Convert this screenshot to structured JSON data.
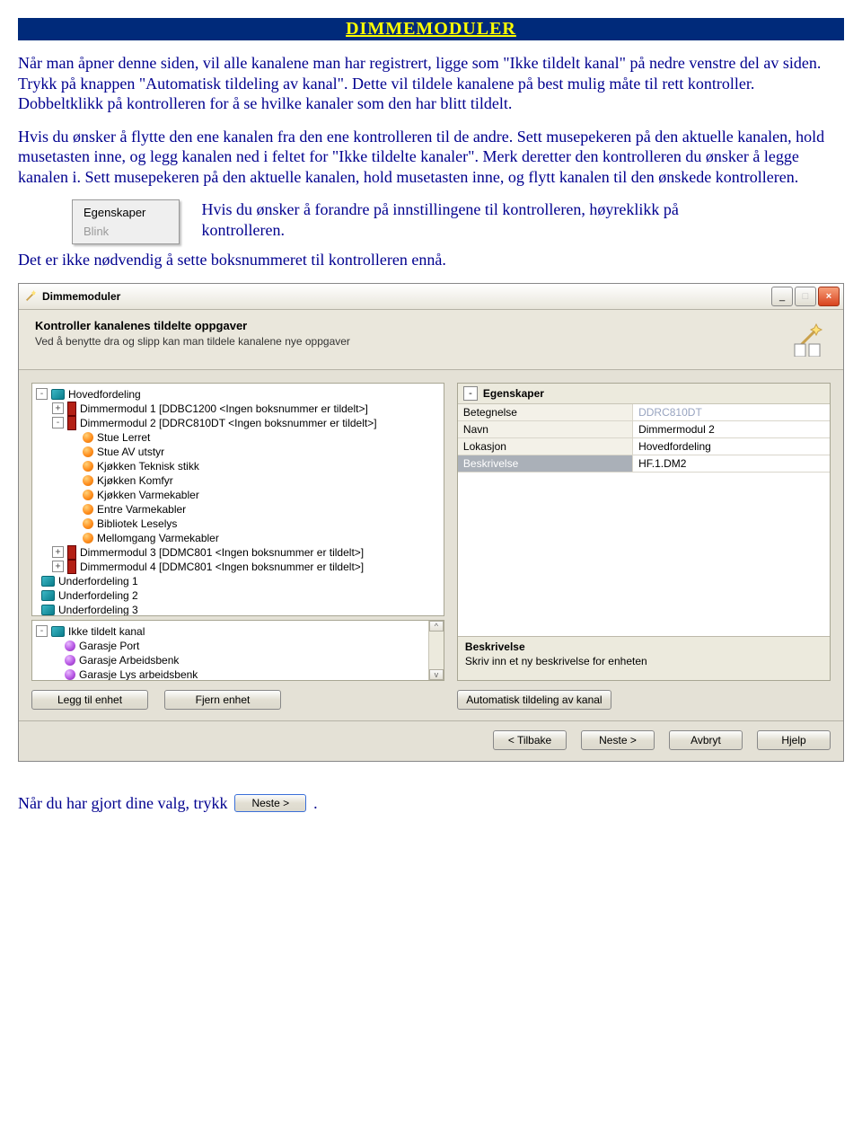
{
  "title": "DIMMEMODULER",
  "para1": "Når man åpner denne siden, vil alle kanalene man har registrert, ligge som \"Ikke tildelt kanal\" på nedre venstre del av siden.",
  "para2": "Trykk på knappen \"Automatisk tildeling av kanal\". Dette vil tildele kanalene på best mulig måte til rett kontroller.",
  "para3": "Dobbeltklikk på kontrolleren for å se hvilke kanaler som den har blitt tildelt.",
  "para4": "Hvis du ønsker å flytte den ene kanalen fra den ene kontrolleren til de andre. Sett musepekeren på den aktuelle kanalen, hold musetasten inne, og legg kanalen ned i feltet for \"Ikke tildelte kanaler\". Merk deretter den kontrolleren du ønsker å legge kanalen i. Sett musepekeren på den aktuelle kanalen, hold musetasten inne, og flytt kanalen til den ønskede kontrolleren.",
  "context_menu": {
    "item1": "Egenskaper",
    "item2": "Blink"
  },
  "para5_right": "Hvis du ønsker å forandre på innstillingene til kontrolleren, høyreklikk på kontrolleren.",
  "para6": "Det er ikke nødvendig å sette boksnummeret til kontrolleren ennå.",
  "window": {
    "title": "Dimmemoduler",
    "header_title": "Kontroller kanalenes tildelte oppgaver",
    "header_sub": "Ved å benytte dra og slipp kan man tildele kanalene nye oppgaver",
    "tree": {
      "root": "Hovedfordeling",
      "dm1": "Dimmermodul 1 [DDBC1200 <Ingen boksnummer er tildelt>]",
      "dm2": "Dimmermodul 2 [DDRC810DT <Ingen boksnummer er tildelt>]",
      "dm2_children": [
        "Stue Lerret",
        "Stue AV utstyr",
        "Kjøkken Teknisk stikk",
        "Kjøkken Komfyr",
        "Kjøkken Varmekabler",
        "Entre Varmekabler",
        "Bibliotek Leselys",
        "Mellomgang Varmekabler"
      ],
      "dm3": "Dimmermodul 3 [DDMC801 <Ingen boksnummer er tildelt>]",
      "dm4": "Dimmermodul 4 [DDMC801 <Ingen boksnummer er tildelt>]",
      "uf1": "Underfordeling 1",
      "uf2": "Underfordeling 2",
      "uf3": "Underfordeling 3",
      "ikke_root": "Ikke tildelt kanal",
      "ikke_children": [
        "Garasje Port",
        "Garasje Arbeidsbenk",
        "Garasje Lys arbeidsbenk"
      ]
    },
    "props": {
      "head": "Egenskaper",
      "rows": [
        {
          "k": "Betegnelse",
          "v": "DDRC810DT",
          "ro": true
        },
        {
          "k": "Navn",
          "v": "Dimmermodul 2"
        },
        {
          "k": "Lokasjon",
          "v": "Hovedfordeling"
        },
        {
          "k": "Beskrivelse",
          "v": "HF.1.DM2",
          "sel": true
        }
      ],
      "desc_title": "Beskrivelse",
      "desc_text": "Skriv inn et ny beskrivelse for enheten"
    },
    "buttons": {
      "add": "Legg til enhet",
      "remove": "Fjern enhet",
      "auto": "Automatisk tildeling av kanal",
      "back": "< Tilbake",
      "next": "Neste >",
      "cancel": "Avbryt",
      "help": "Hjelp"
    }
  },
  "end_text": "Når du har gjort dine valg, trykk",
  "end_btn": "Neste >"
}
